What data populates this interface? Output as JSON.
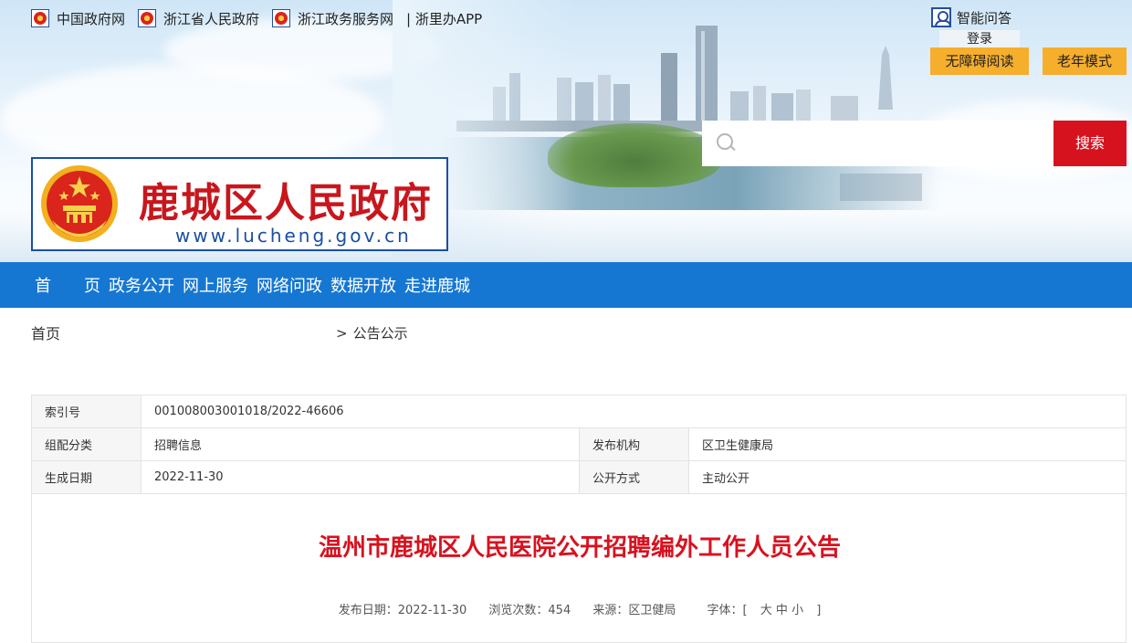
{
  "header": {
    "top_links": [
      "中国政府网",
      "浙江省人民政府",
      "浙江政务服务网"
    ],
    "zlb_link": "| 浙里办APP",
    "qa": "智能问答",
    "login": "登录",
    "accessible_button": "无障碍阅读",
    "elder_button": "老年模式",
    "search": {
      "placeholder": "",
      "button": "搜索"
    },
    "logo": {
      "title": "鹿城区人民政府",
      "url": "www.lucheng.gov.cn"
    }
  },
  "nav": {
    "items": [
      "首",
      "页",
      "政务公开",
      "网上服务",
      "网络问政",
      "数据开放",
      "走进鹿城"
    ]
  },
  "breadcrumb": {
    "home": "首页",
    "separator": ">",
    "current": "公告公示"
  },
  "info": {
    "index_label": "索引号",
    "index_value": "001008003001018/2022-46606",
    "category_label": "组配分类",
    "category_value": "招聘信息",
    "org_label": "发布机构",
    "org_value": "区卫生健康局",
    "date_label": "生成日期",
    "date_value": "2022-11-30",
    "open_label": "公开方式",
    "open_value": "主动公开"
  },
  "article": {
    "title": "温州市鹿城区人民医院公开招聘编外工作人员公告",
    "meta": {
      "date": "发布日期：2022-11-30",
      "views": "浏览次数：454",
      "source": "来源：区卫健局",
      "font_label": "字体：[",
      "font_large": "大",
      "font_medium": "中",
      "font_small": "小",
      "font_end": "]"
    }
  },
  "colors": {
    "nav": "#1677d2",
    "accent_red": "#d7121f",
    "mode_button": "#f6ae2d"
  }
}
